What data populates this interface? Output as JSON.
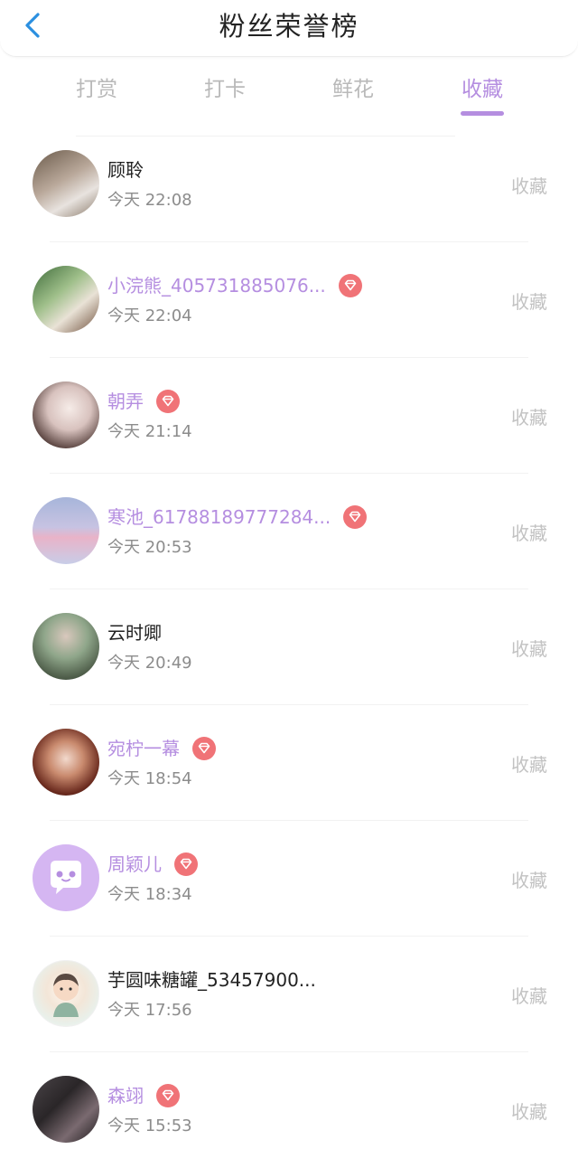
{
  "header": {
    "title": "粉丝荣誉榜"
  },
  "tabs": [
    {
      "label": "打赏"
    },
    {
      "label": "打卡"
    },
    {
      "label": "鲜花"
    },
    {
      "label": "收藏"
    }
  ],
  "active_tab": "收藏",
  "colors": {
    "accent": "#b58ee0",
    "badge": "#f07377",
    "back": "#2b8fe0"
  },
  "rows": [
    {
      "name": "顾聆",
      "time": "今天 22:08",
      "vip": false,
      "action": "收藏"
    },
    {
      "name": "小浣熊_405731885076...",
      "time": "今天 22:04",
      "vip": true,
      "action": "收藏"
    },
    {
      "name": "朝弄",
      "time": "今天 21:14",
      "vip": true,
      "action": "收藏"
    },
    {
      "name": "寒池_61788189777284...",
      "time": "今天 20:53",
      "vip": true,
      "action": "收藏"
    },
    {
      "name": "云时卿",
      "time": "今天 20:49",
      "vip": false,
      "action": "收藏"
    },
    {
      "name": "宛柠一幕",
      "time": "今天 18:54",
      "vip": true,
      "action": "收藏"
    },
    {
      "name": "周颖儿",
      "time": "今天 18:34",
      "vip": true,
      "action": "收藏"
    },
    {
      "name": "芋圆味糖罐_53457900...",
      "time": "今天 17:56",
      "vip": false,
      "action": "收藏"
    },
    {
      "name": "森翊",
      "time": "今天 15:53",
      "vip": true,
      "action": "收藏"
    }
  ]
}
